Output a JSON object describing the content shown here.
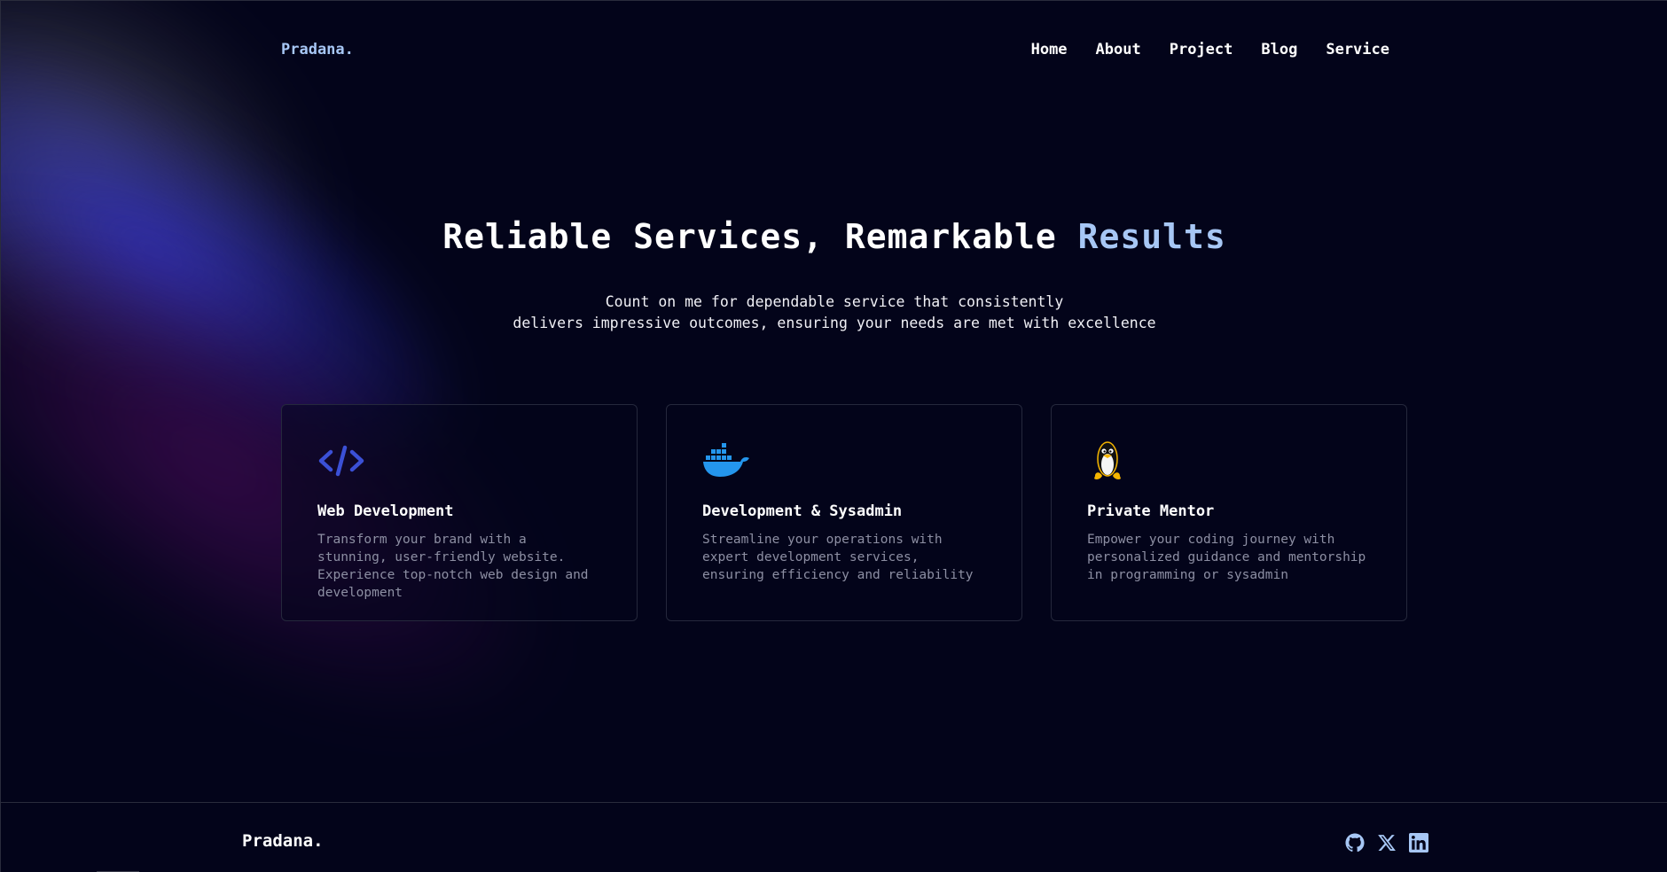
{
  "header": {
    "logo": "Pradana.",
    "nav": [
      "Home",
      "About",
      "Project",
      "Blog",
      "Service"
    ]
  },
  "hero": {
    "title_main": "Reliable Services, Remarkable",
    "title_accent": "Results",
    "subtitle_lines": [
      "Count on me for dependable service that consistently",
      "delivers impressive outcomes, ensuring your needs are met with excellence"
    ]
  },
  "cards": [
    {
      "icon": "code-icon",
      "title": "Web Development",
      "description": "Transform your brand with a stunning, user-friendly website. Experience top-notch web design and development"
    },
    {
      "icon": "docker-icon",
      "title": "Development & Sysadmin",
      "description": "Streamline your operations with expert development services, ensuring efficiency and reliability"
    },
    {
      "icon": "linux-tux-icon",
      "title": "Private Mentor",
      "description": "Empower your coding journey with personalized guidance and mentorship in programming or sysadmin"
    }
  ],
  "footer": {
    "logo": "Pradana.",
    "social": [
      "github-icon",
      "x-twitter-icon",
      "linkedin-icon"
    ]
  },
  "colors": {
    "background": "#03041a",
    "accent": "#a7c7f5",
    "code_icon": "#3b50d6",
    "docker_icon": "#2496ed",
    "tux_yellow": "#f5b500",
    "social_icon": "#a7c7f5"
  }
}
